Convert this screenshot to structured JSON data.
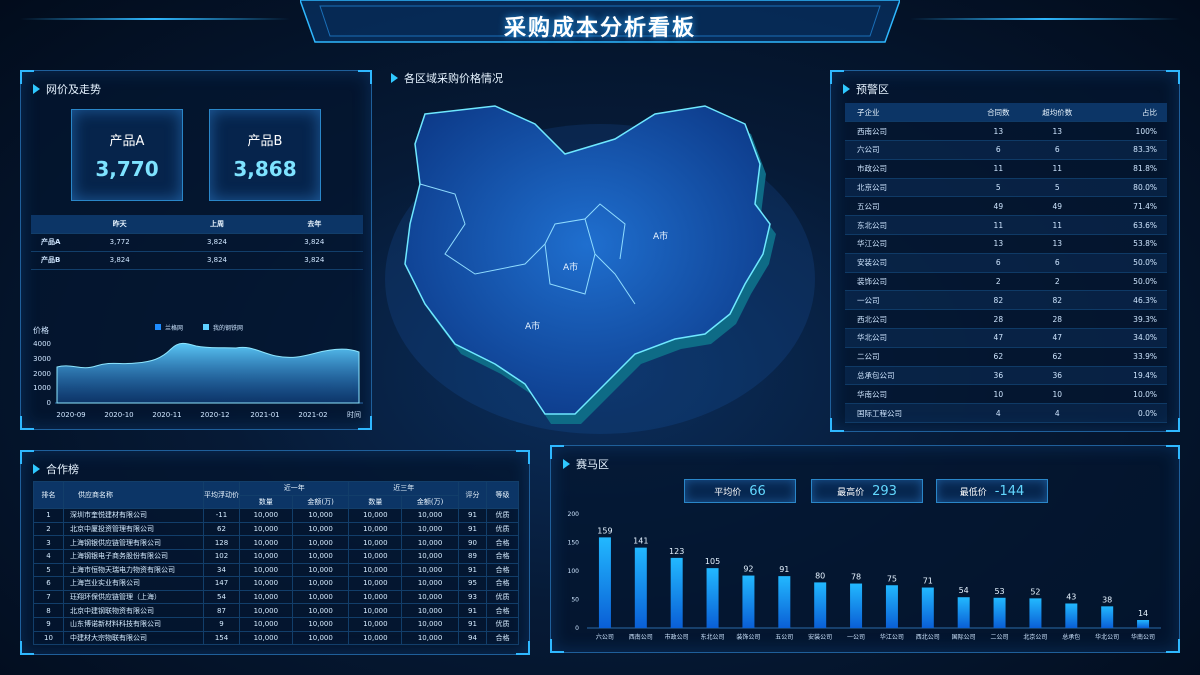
{
  "title": "采购成本分析看板",
  "panels": {
    "price": "网价及走势",
    "map": "各区域采购价格情况",
    "warning": "预警区",
    "cooperation": "合作榜",
    "race": "赛马区"
  },
  "products": [
    {
      "name": "产品A",
      "value": "3,770"
    },
    {
      "name": "产品B",
      "value": "3,868"
    }
  ],
  "price_table": {
    "headers": [
      "",
      "昨天",
      "上周",
      "去年"
    ],
    "rows": [
      [
        "产品A",
        "3,772",
        "3,824",
        "3,824"
      ],
      [
        "产品B",
        "3,824",
        "3,824",
        "3,824"
      ]
    ]
  },
  "map_labels": [
    "A市",
    "A市",
    "A市"
  ],
  "area_chart": {
    "ylabel": "价格",
    "xlabel": "时间",
    "legend": [
      "兰格网",
      "我的钢铁网"
    ],
    "yticks": [
      "4000",
      "3000",
      "2000",
      "1000",
      "0"
    ],
    "xticks": [
      "2020-09",
      "2020-10",
      "2020-11",
      "2020-12",
      "2021-01",
      "2021-02"
    ]
  },
  "warning_table": {
    "headers": [
      "子企业",
      "合同数",
      "超均价数",
      "占比"
    ],
    "rows": [
      [
        "西南公司",
        "13",
        "13",
        "100%"
      ],
      [
        "六公司",
        "6",
        "6",
        "83.3%"
      ],
      [
        "市政公司",
        "11",
        "11",
        "81.8%"
      ],
      [
        "北京公司",
        "5",
        "5",
        "80.0%"
      ],
      [
        "五公司",
        "49",
        "49",
        "71.4%"
      ],
      [
        "东北公司",
        "11",
        "11",
        "63.6%"
      ],
      [
        "华江公司",
        "13",
        "13",
        "53.8%"
      ],
      [
        "安装公司",
        "6",
        "6",
        "50.0%"
      ],
      [
        "装饰公司",
        "2",
        "2",
        "50.0%"
      ],
      [
        "一公司",
        "82",
        "82",
        "46.3%"
      ],
      [
        "西北公司",
        "28",
        "28",
        "39.3%"
      ],
      [
        "华北公司",
        "47",
        "47",
        "34.0%"
      ],
      [
        "二公司",
        "62",
        "62",
        "33.9%"
      ],
      [
        "总承包公司",
        "36",
        "36",
        "19.4%"
      ],
      [
        "华南公司",
        "10",
        "10",
        "10.0%"
      ],
      [
        "国际工程公司",
        "4",
        "4",
        "0.0%"
      ]
    ]
  },
  "coop_table": {
    "h_rank": "排名",
    "h_supplier": "供应商名称",
    "h_float": "平均浮动价",
    "h_year1": "近一年",
    "h_year3": "近三年",
    "h_qty": "数量",
    "h_amount": "金额(万)",
    "h_score": "评分",
    "h_grade": "等级",
    "rows": [
      [
        "1",
        "深圳市奎悦建材有限公司",
        "-11",
        "10,000",
        "10,000",
        "10,000",
        "10,000",
        "91",
        "优质"
      ],
      [
        "2",
        "北京中厦投资管理有限公司",
        "62",
        "10,000",
        "10,000",
        "10,000",
        "10,000",
        "91",
        "优质"
      ],
      [
        "3",
        "上海钢银供应链管理有限公司",
        "128",
        "10,000",
        "10,000",
        "10,000",
        "10,000",
        "90",
        "合格"
      ],
      [
        "4",
        "上海钢银电子商务股份有限公司",
        "102",
        "10,000",
        "10,000",
        "10,000",
        "10,000",
        "89",
        "合格"
      ],
      [
        "5",
        "上海市恒物天瑞电力物资有限公司",
        "34",
        "10,000",
        "10,000",
        "10,000",
        "10,000",
        "91",
        "合格"
      ],
      [
        "6",
        "上海岂业实业有限公司",
        "147",
        "10,000",
        "10,000",
        "10,000",
        "10,000",
        "95",
        "合格"
      ],
      [
        "7",
        "珏翔环保供应链管理（上海）",
        "54",
        "10,000",
        "10,000",
        "10,000",
        "10,000",
        "93",
        "优质"
      ],
      [
        "8",
        "北京中建钢联物资有限公司",
        "87",
        "10,000",
        "10,000",
        "10,000",
        "10,000",
        "91",
        "合格"
      ],
      [
        "9",
        "山东博诺新材料科技有限公司",
        "9",
        "10,000",
        "10,000",
        "10,000",
        "10,000",
        "91",
        "优质"
      ],
      [
        "10",
        "中建材大宗物联有限公司",
        "154",
        "10,000",
        "10,000",
        "10,000",
        "10,000",
        "94",
        "合格"
      ]
    ]
  },
  "race_stats": [
    {
      "label": "平均价",
      "value": "66"
    },
    {
      "label": "最高价",
      "value": "293"
    },
    {
      "label": "最低价",
      "value": "-144"
    }
  ],
  "chart_data": {
    "type": "bar",
    "categories": [
      "六公司",
      "西南公司",
      "市政公司",
      "东北公司",
      "装饰公司",
      "五公司",
      "安装公司",
      "一公司",
      "华江公司",
      "西北公司",
      "国际公司",
      "二公司",
      "北京公司",
      "总承包",
      "华北公司",
      "华南公司"
    ],
    "values": [
      159,
      141,
      123,
      105,
      92,
      91,
      80,
      78,
      75,
      71,
      54,
      53,
      52,
      43,
      38,
      14
    ],
    "yticks": [
      "200",
      "150",
      "100",
      "50",
      "0"
    ],
    "ylim": [
      0,
      200
    ]
  },
  "colors": {
    "accent": "#2fb8ff",
    "bar": "#1aa9ff",
    "series1": "#1e8cff",
    "series2": "#5fd0ff"
  }
}
